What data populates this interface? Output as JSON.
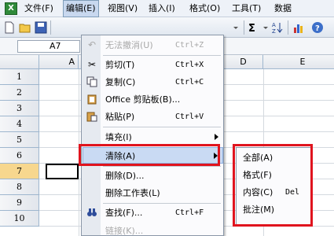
{
  "menubar": {
    "items": [
      {
        "label": "文件(F)"
      },
      {
        "label": "编辑(E)"
      },
      {
        "label": "视图(V)"
      },
      {
        "label": "插入(I)"
      },
      {
        "label": "格式(O)"
      },
      {
        "label": "工具(T)"
      },
      {
        "label": "数据"
      }
    ]
  },
  "namebox": {
    "value": "A7"
  },
  "columns": [
    "A",
    "D",
    "E"
  ],
  "rows": [
    "1",
    "2",
    "3",
    "4",
    "5",
    "6",
    "7",
    "8",
    "9",
    "10"
  ],
  "edit_menu": {
    "items": [
      {
        "label": "无法撤消(U)",
        "shortcut": "Ctrl+Z",
        "icon": "undo-icon"
      },
      {
        "label": "剪切(T)",
        "shortcut": "Ctrl+X",
        "icon": "scissors-icon"
      },
      {
        "label": "复制(C)",
        "shortcut": "Ctrl+C",
        "icon": "copy-icon"
      },
      {
        "label": "Office 剪贴板(B)...",
        "shortcut": "",
        "icon": "clipboard-icon"
      },
      {
        "label": "粘贴(P)",
        "shortcut": "Ctrl+V",
        "icon": "paste-icon"
      },
      {
        "label": "填充(I)",
        "shortcut": "",
        "icon": ""
      },
      {
        "label": "清除(A)",
        "shortcut": "",
        "icon": ""
      },
      {
        "label": "删除(D)...",
        "shortcut": "",
        "icon": ""
      },
      {
        "label": "删除工作表(L)",
        "shortcut": "",
        "icon": ""
      },
      {
        "label": "查找(F)...",
        "shortcut": "Ctrl+F",
        "icon": "binoculars-icon"
      },
      {
        "label": "链接(K)...",
        "shortcut": "",
        "icon": ""
      }
    ]
  },
  "clear_submenu": {
    "items": [
      {
        "label": "全部(A)",
        "shortcut": ""
      },
      {
        "label": "格式(F)",
        "shortcut": ""
      },
      {
        "label": "内容(C)",
        "shortcut": "Del"
      },
      {
        "label": "批注(M)",
        "shortcut": ""
      }
    ]
  },
  "colors": {
    "highlight_border": "#e0141e",
    "menu_highlight": "#c9daf3"
  }
}
